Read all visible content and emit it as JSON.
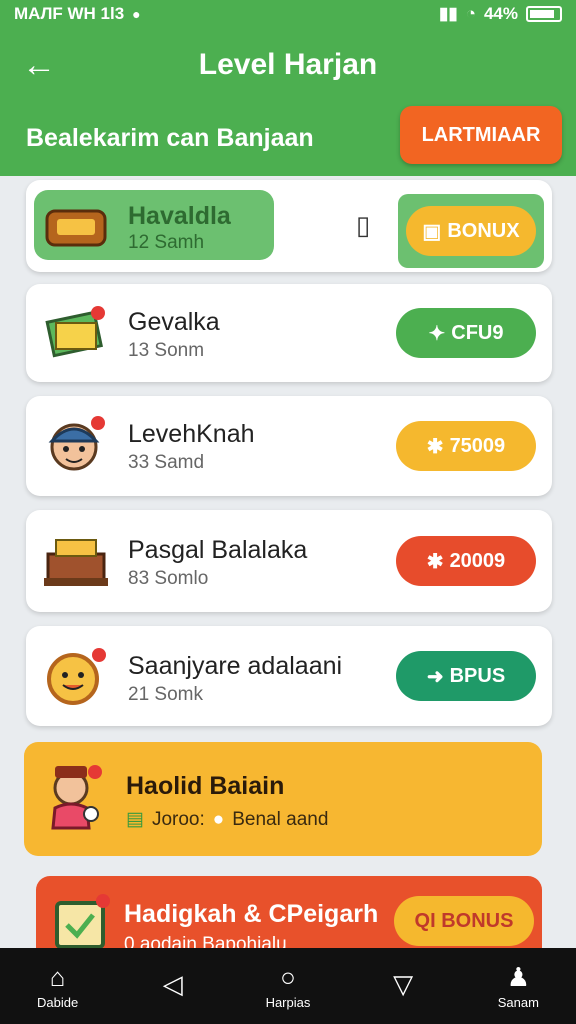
{
  "status": {
    "left": "MAЛF WH 1l3",
    "right": "44%"
  },
  "header": {
    "title": "Level Harjan",
    "subtitle": "Bealekarim can Banjaan",
    "action_label": "LARTMIAAR"
  },
  "rows": [
    {
      "title": "Havaldla",
      "sub": "12 Samh",
      "pill": "BONUX",
      "pill_glyph": "▣"
    },
    {
      "title": "Gevalka",
      "sub": "13 Sonm",
      "pill": "CFU9",
      "pill_glyph": "✦"
    },
    {
      "title": "LevehKnah",
      "sub": "33 Samd",
      "pill": "75009",
      "pill_glyph": "✱"
    },
    {
      "title": "Pasgal Balalaka",
      "sub": "83 Somlo",
      "pill": "20009",
      "pill_glyph": "✱"
    },
    {
      "title": "Saanjyare adalaani",
      "sub": "21 Somk",
      "pill": "BPUS",
      "pill_glyph": "➜"
    },
    {
      "title": "Haolid Baiain",
      "sub_a": "Joroo:",
      "sub_b": "Benal aand"
    },
    {
      "title": "Hadigkah & CPeigarh",
      "sub": "0 aodain Bapohialu",
      "pill": "QI BONUS"
    }
  ],
  "nav": [
    {
      "label": "Dabide",
      "icon": "home-icon"
    },
    {
      "label": "",
      "icon": "back-triangle-icon"
    },
    {
      "label": "Harpias",
      "icon": "circle-home-icon"
    },
    {
      "label": "",
      "icon": "down-triangle-icon"
    },
    {
      "label": "Sanam",
      "icon": "person-icon"
    }
  ],
  "colors": {
    "green": "#4caf50",
    "orange": "#f26522",
    "yellow_pill": "#f5b82e",
    "red_pill": "#e74c2c",
    "teal_pill": "#1f9a68"
  }
}
